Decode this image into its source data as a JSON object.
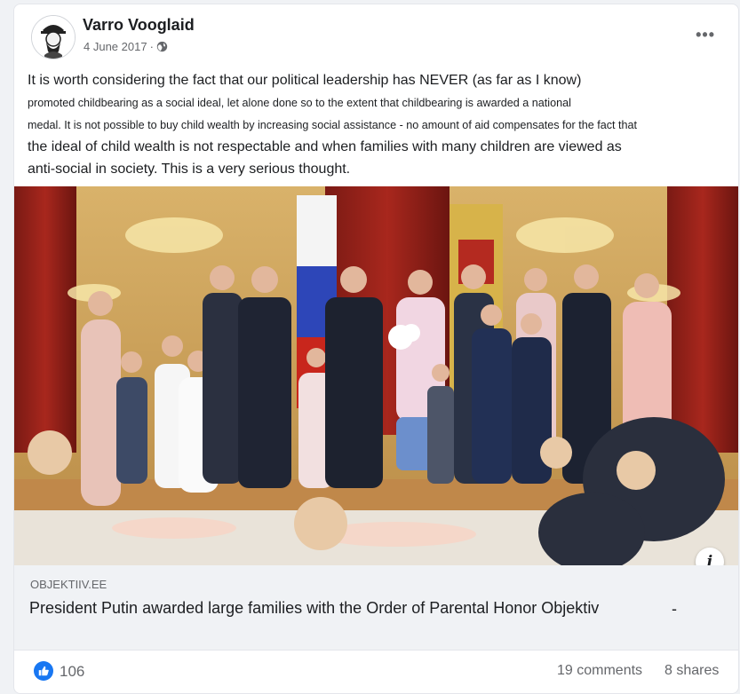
{
  "post": {
    "author": "Varro Vooglaid",
    "date": "4 June 2017",
    "separator": "·",
    "privacy_icon": "globe-icon",
    "more_icon": "more-options-icon",
    "more_label": "•••",
    "text": {
      "line1": "It is worth considering the fact that our political leadership has NEVER (as far as I know)",
      "line2": "promoted childbearing as a social ideal, let alone done so to the extent that childbearing is awarded a national",
      "line3": "medal. It is not possible to buy child wealth by increasing social assistance - no amount of aid compensates for the fact that",
      "line4": "the ideal of child wealth is not respectable and when families with many children are viewed as",
      "line5": "anti-social in society. This is a very serious thought."
    }
  },
  "link_preview": {
    "source": "OBJEKTIIV.EE",
    "headline": "President Putin awarded large families with the Order of Parental Honor Objektiv",
    "trailing": "-",
    "info_label": "i"
  },
  "stats": {
    "like_count": "106",
    "comments": "19 comments",
    "shares": "8 shares"
  },
  "colors": {
    "accent": "#1877f2",
    "secondary_text": "#65676b",
    "link_box_bg": "#f0f2f5"
  }
}
